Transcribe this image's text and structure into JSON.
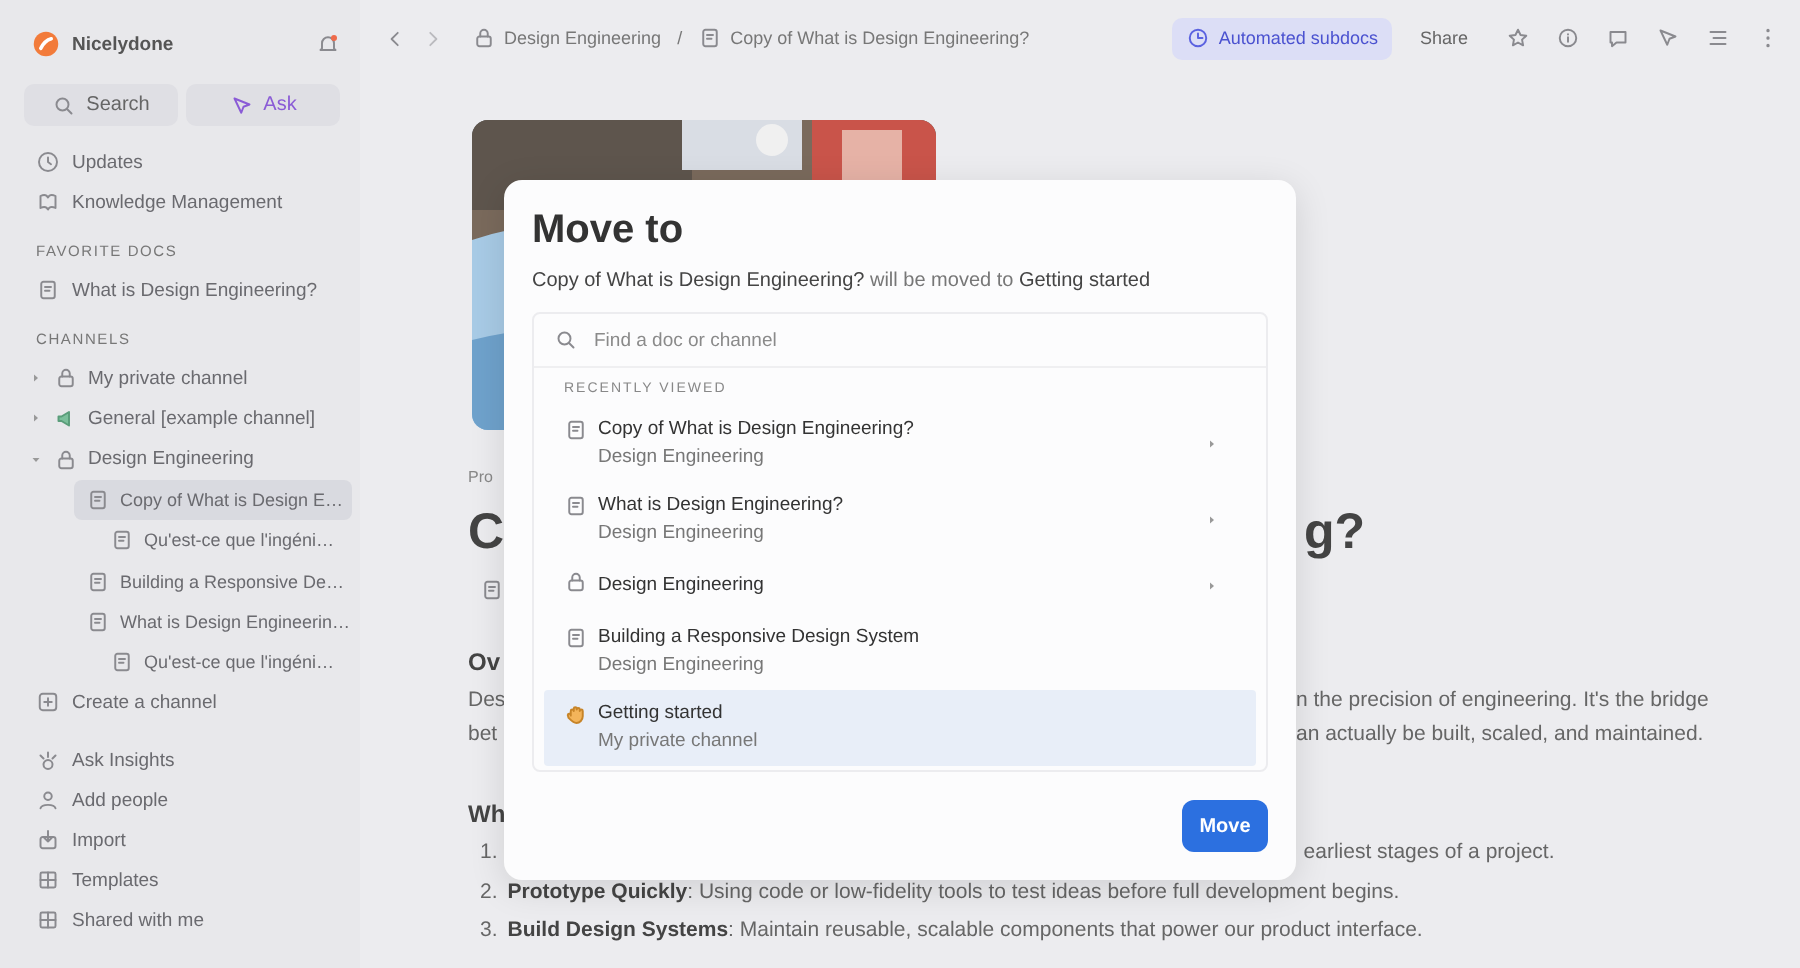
{
  "sidebar": {
    "workspace": "Nicelydone",
    "search_button": "Search",
    "ask_button": "Ask",
    "nav": [
      {
        "label": "Updates",
        "kind": "clock"
      },
      {
        "label": "Knowledge Management",
        "kind": "book"
      }
    ],
    "favorites_header": "FAVORITE DOCS",
    "favorites": [
      {
        "label": "What is Design Engineering?",
        "kind": "doc"
      }
    ],
    "channels_header": "CHANNELS",
    "channels": [
      {
        "label": "My private channel",
        "kind": "lock",
        "expanded": false,
        "selected": false
      },
      {
        "label": "General [example channel]",
        "kind": "megaphone",
        "expanded": false,
        "selected": false
      },
      {
        "label": "Design Engineering",
        "kind": "lock",
        "expanded": true,
        "selected": false,
        "children": [
          {
            "label": "Copy of What is Design E…",
            "kind": "doc",
            "selected": true,
            "children": [
              {
                "label": "Qu'est-ce que l'ingéni…",
                "kind": "doc",
                "selected": false
              }
            ]
          },
          {
            "label": "Building a Responsive De…",
            "kind": "doc",
            "selected": false
          },
          {
            "label": "What is Design Engineerin…",
            "kind": "doc",
            "selected": false,
            "children": [
              {
                "label": "Qu'est-ce que l'ingéni…",
                "kind": "doc",
                "selected": false
              }
            ]
          }
        ]
      }
    ],
    "create_channel": "Create a channel",
    "actions": [
      {
        "label": "Ask Insights",
        "kind": "spark"
      },
      {
        "label": "Add people",
        "kind": "person"
      },
      {
        "label": "Import",
        "kind": "import"
      },
      {
        "label": "Templates",
        "kind": "grid"
      },
      {
        "label": "Shared with me",
        "kind": "grid"
      }
    ]
  },
  "topbar": {
    "breadcrumbs": [
      {
        "label": "Design Engineering",
        "kind": "lock"
      },
      {
        "label": "Copy of What is Design Engineering?",
        "kind": "doc"
      }
    ],
    "separator": "/",
    "automation_button": "Automated subdocs",
    "share_button": "Share"
  },
  "content": {
    "label": "Pro",
    "title_start": "C",
    "title_end": "g?",
    "heading_1": "Ov",
    "paragraph": [
      {
        "start": "Des",
        "end": "n the precision of engineering. It's the bridge"
      },
      {
        "start": "bet",
        "end": "an actually be built, scaled, and maintained."
      }
    ],
    "heading_2": "Wh",
    "list": [
      {
        "number": "1.",
        "end": "earliest stages of a project."
      },
      {
        "number": "2.",
        "text": "**Prototype Quickly**: Using code or low-fidelity tools to test ideas before full development begins."
      },
      {
        "number": "3.",
        "text": "**Build Design Systems**: Maintain reusable, scalable components that power our product interface."
      }
    ]
  },
  "dialog": {
    "title": "Move to",
    "message": {
      "doc": "Copy of What is Design Engineering?",
      "connector": "will be moved to",
      "target": "Getting started"
    },
    "search": {
      "placeholder": "Find a doc or channel"
    },
    "section": "RECENTLY VIEWED",
    "items": [
      {
        "title": "Copy of What is Design Engineering?",
        "subtitle": "Design Engineering",
        "kind": "doc",
        "expandable": true,
        "selected": false
      },
      {
        "title": "What is Design Engineering?",
        "subtitle": "Design Engineering",
        "kind": "doc",
        "expandable": true,
        "selected": false
      },
      {
        "title": "Design Engineering",
        "kind": "lock",
        "expandable": true,
        "selected": false
      },
      {
        "title": "Building a Responsive Design System",
        "subtitle": "Design Engineering",
        "kind": "doc",
        "expandable": false,
        "selected": false
      },
      {
        "title": "Getting started",
        "subtitle": "My private channel",
        "kind": "hand",
        "expandable": false,
        "selected": true
      }
    ],
    "confirm_button": "Move"
  }
}
